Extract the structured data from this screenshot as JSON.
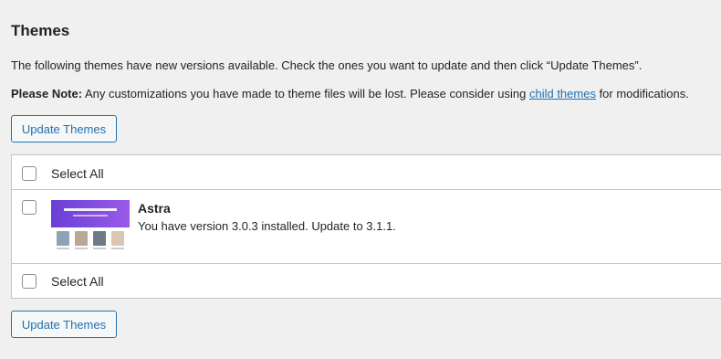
{
  "page": {
    "title": "Themes",
    "description": "The following themes have new versions available. Check the ones you want to update and then click “Update Themes”.",
    "note": {
      "label": "Please Note:",
      "before_link": " Any customizations you have made to theme files will be lost. Please consider using ",
      "link_text": "child themes",
      "after_link": " for modifications."
    }
  },
  "buttons": {
    "update_top": "Update Themes",
    "update_bottom": "Update Themes"
  },
  "table": {
    "select_all_top": "Select All",
    "select_all_bottom": "Select All",
    "themes": [
      {
        "name": "Astra",
        "info": "You have version 3.0.3 installed. Update to 3.1.1.",
        "checked": false
      }
    ]
  },
  "colors": {
    "accent": "#2271b1",
    "background": "#f0f0f1",
    "border": "#c3c4c7",
    "screenshot_purple": "#7b4ae0"
  }
}
